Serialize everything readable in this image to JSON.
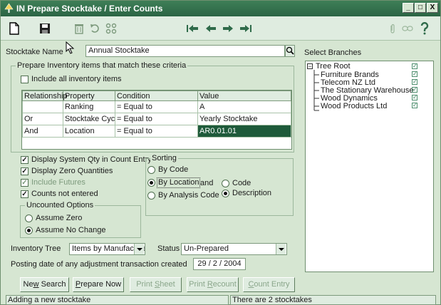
{
  "window": {
    "title": "IN Prepare Stocktake / Enter Counts",
    "controls": [
      "_",
      "□",
      "X"
    ]
  },
  "stocktake": {
    "name_label": "Stocktake Name",
    "name_value": "Annual Stocktake"
  },
  "criteria": {
    "group_label": "Prepare Inventory items that match these criteria",
    "include_all_label": "Include all inventory items",
    "include_all_checked": false,
    "columns": [
      "Relationship",
      "Property",
      "Condition",
      "Value"
    ],
    "rows": [
      [
        "",
        "Ranking",
        "= Equal to",
        "A"
      ],
      [
        "Or",
        "Stocktake Cycle",
        "= Equal to",
        "Yearly Stocktake"
      ],
      [
        "And",
        "Location",
        "= Equal to",
        "AR0.01.01"
      ]
    ]
  },
  "options": {
    "display_system_qty": "Display System Qty in Count Entry",
    "display_zero": "Display Zero Quantities",
    "include_futures": "Include Futures",
    "counts_not_entered": "Counts not entered"
  },
  "uncounted": {
    "group_label": "Uncounted Options",
    "assume_zero": "Assume Zero",
    "assume_no_change": "Assume No Change"
  },
  "sorting": {
    "group_label": "Sorting",
    "by_code": "By Code",
    "by_location": "By Location",
    "and_label": "and",
    "code": "Code",
    "by_analysis_code": "By Analysis Code",
    "description": "Description"
  },
  "inventory_tree": {
    "label": "Inventory Tree",
    "value": "Items by Manufacture"
  },
  "status": {
    "label": "Status",
    "value": "Un-Prepared"
  },
  "posting": {
    "label": "Posting date of any adjustment transaction created",
    "value": "29 / 2 / 2004"
  },
  "branches": {
    "label": "Select Branches",
    "root": "Tree Root",
    "items": [
      "Furniture Brands",
      "Telecom NZ Ltd",
      "The Stationary Warehouse",
      "Wood Dynamics",
      "Wood Products Ltd"
    ]
  },
  "buttons": {
    "new_search_pre": "Ne",
    "new_search_u": "w",
    "new_search_post": " Search",
    "prepare_now_u": "P",
    "prepare_now_post": "repare Now",
    "print_sheet_pre": "Print ",
    "print_sheet_u": "S",
    "print_sheet_post": "heet",
    "print_recount_pre": "Print ",
    "print_recount_u": "R",
    "print_recount_post": "ecount",
    "count_entry_u": "C",
    "count_entry_post": "ount Entry"
  },
  "statusbar": {
    "left": "Adding a new stocktake",
    "right": "There are 2 stocktakes"
  },
  "colors": {
    "titlebar": "#2f6b4a",
    "selection": "#1e5a3a",
    "background": "#d6e6d2"
  }
}
